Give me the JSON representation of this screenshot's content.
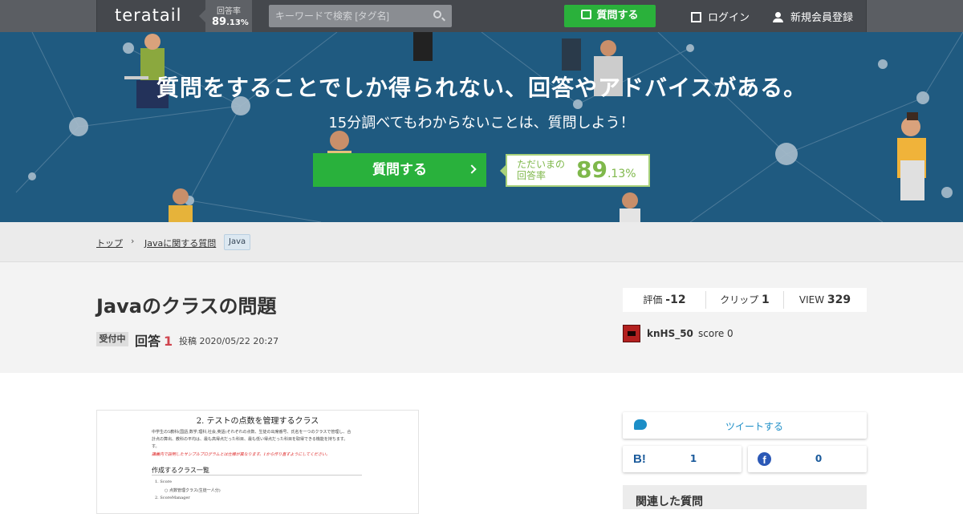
{
  "header": {
    "logo": "teratail",
    "rate_label": "回答率",
    "rate_int": "89",
    "rate_dec": ".13%",
    "search_placeholder": "キーワードで検索 [タグ名]",
    "ask_label": "質問する",
    "login_label": "ログイン",
    "register_label": "新規会員登録"
  },
  "hero": {
    "title": "質問をすることでしか得られない、回答やアドバイスがある。",
    "subtitle": "15分調べてもわからないことは、質問しよう！",
    "ask_label": "質問する",
    "rate_label_1": "ただいまの",
    "rate_label_2": "回答率",
    "rate_int": "89",
    "rate_dec": ".13%"
  },
  "breadcrumb": {
    "items": [
      "トップ",
      "Javaに関する質問"
    ],
    "separator": "›",
    "tag": "Java"
  },
  "question": {
    "title": "Javaのクラスの問題",
    "status": "受付中",
    "answers_label": "回答",
    "answers_count": "1",
    "posted": "投稿 2020/05/22 20:27",
    "stats": {
      "rating_label": "評価",
      "rating_value": "-12",
      "clip_label": "クリップ",
      "clip_value": "1",
      "view_label": "VIEW",
      "view_value": "329"
    },
    "user": {
      "name": "knHS_50",
      "score": "score 0"
    }
  },
  "document": {
    "heading": "2. テストの点数を管理するクラス",
    "para1": "中学生の5教科(国語,数学,理科,社会,英語)それぞれの点数、生徒の出席番号、氏名を一つのクラスで管理し、合",
    "para2": "計点の算出、教科の平均は、最も高得点だった科目、最も低い得点だった科目を取得できる機能を持ちます。",
    "para3": "す。",
    "para_red": "講義内で説明したサンプルプログラムとは仕様が異なります。1から作り直すようにしてください。",
    "sub_heading": "作成するクラス一覧",
    "list1": "1.  Score",
    "list1a": "○  点数管理クラス(生徒一人分)",
    "list2": "2.  ScoreManager"
  },
  "sidebar": {
    "tweet_label": "ツイートする",
    "hatena_icon_text": "B!",
    "hatena_count": "1",
    "facebook_icon_text": "f",
    "facebook_count": "0",
    "related_title": "関連した質問"
  }
}
